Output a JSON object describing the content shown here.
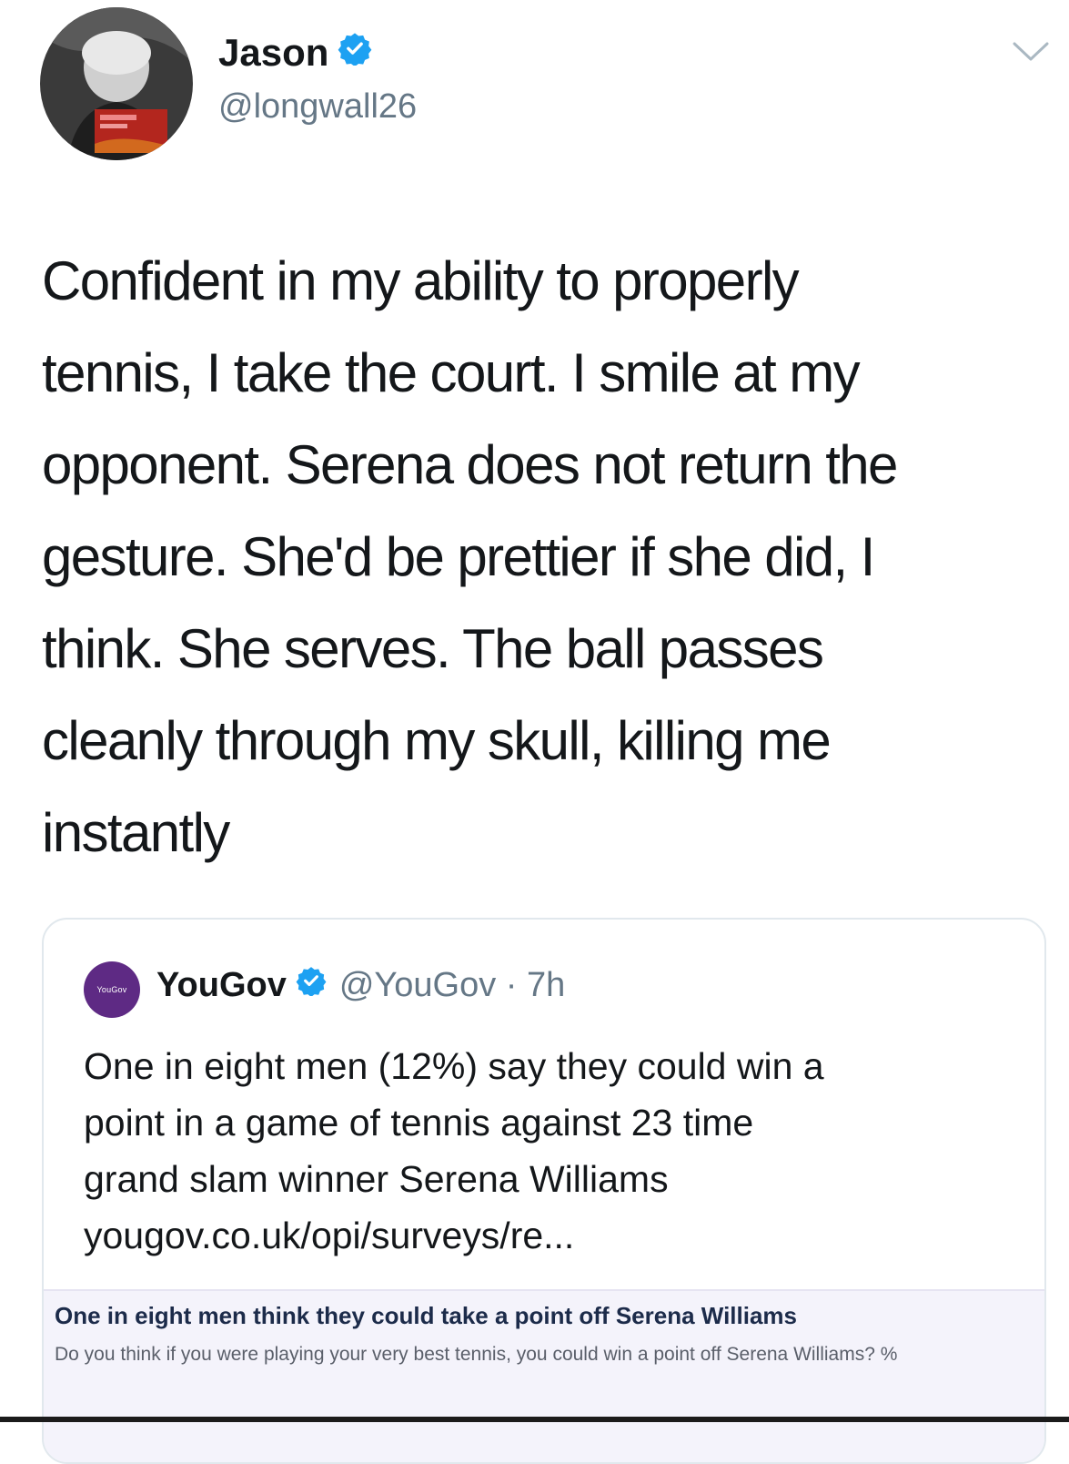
{
  "tweet": {
    "author": {
      "name": "Jason",
      "handle": "@longwall26",
      "verified": true,
      "avatar_icon": "profile-photo"
    },
    "text_lines": [
      "Confident in my ability to properly",
      "tennis, I take the court. I smile at my",
      "opponent. Serena does not return the",
      "gesture. She'd be prettier if she did, I",
      "think. She serves. The ball passes",
      "cleanly through my skull, killing me",
      "instantly"
    ],
    "menu_icon": "chevron-down-icon"
  },
  "quoted_tweet": {
    "author": {
      "name": "YouGov",
      "handle_time": "@YouGov · 7h",
      "verified": true,
      "avatar_text": "YouGov"
    },
    "text_lines": [
      "One in eight men (12%) say they could win a",
      "point in a game of tennis against 23 time",
      "grand slam winner Serena Williams",
      "yougov.co.uk/opi/surveys/re..."
    ],
    "link_card": {
      "title": "One in eight men think they could take a point off Serena Williams",
      "description": "Do you think if you were playing your very best tennis, you could win a point off Serena Williams? %"
    }
  },
  "colors": {
    "verified_blue": "#1da1f2",
    "secondary_text": "#657786",
    "yougov_purple": "#5e2a84"
  }
}
